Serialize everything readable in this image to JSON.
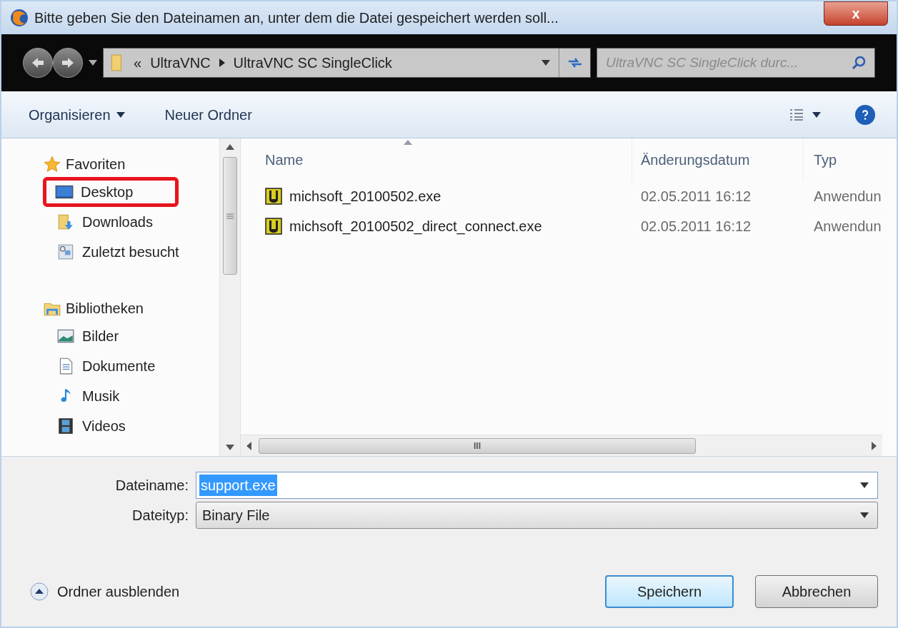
{
  "window": {
    "title": "Bitte geben Sie den Dateinamen an, unter dem die Datei gespeichert werden soll...",
    "close_label": "x"
  },
  "address_bar": {
    "overflow": "«",
    "path": [
      "UltraVNC",
      "UltraVNC SC SingleClick"
    ],
    "search_placeholder": "UltraVNC SC SingleClick durc..."
  },
  "toolbar": {
    "organize": "Organisieren",
    "new_folder": "Neuer Ordner"
  },
  "sidebar": {
    "groups": [
      {
        "label": "Favoriten",
        "children": [
          {
            "label": "Desktop",
            "highlighted": true
          },
          {
            "label": "Downloads",
            "highlighted": false
          },
          {
            "label": "Zuletzt besucht",
            "highlighted": false
          }
        ]
      },
      {
        "label": "Bibliotheken",
        "children": [
          {
            "label": "Bilder",
            "highlighted": false
          },
          {
            "label": "Dokumente",
            "highlighted": false
          },
          {
            "label": "Musik",
            "highlighted": false
          },
          {
            "label": "Videos",
            "highlighted": false
          }
        ]
      }
    ]
  },
  "file_list": {
    "columns": [
      "Name",
      "Änderungsdatum",
      "Typ"
    ],
    "rows": [
      {
        "name": "michsoft_20100502.exe",
        "date": "02.05.2011 16:12",
        "type": "Anwendun"
      },
      {
        "name": "michsoft_20100502_direct_connect.exe",
        "date": "02.05.2011 16:12",
        "type": "Anwendun"
      }
    ],
    "scrollbar_grip": "III"
  },
  "form": {
    "filename_label": "Dateiname:",
    "filename_value": "support.exe",
    "filetype_label": "Dateityp:",
    "filetype_value": "Binary File"
  },
  "footer": {
    "hide_folders": "Ordner ausblenden",
    "save": "Speichern",
    "cancel": "Abbrechen"
  }
}
